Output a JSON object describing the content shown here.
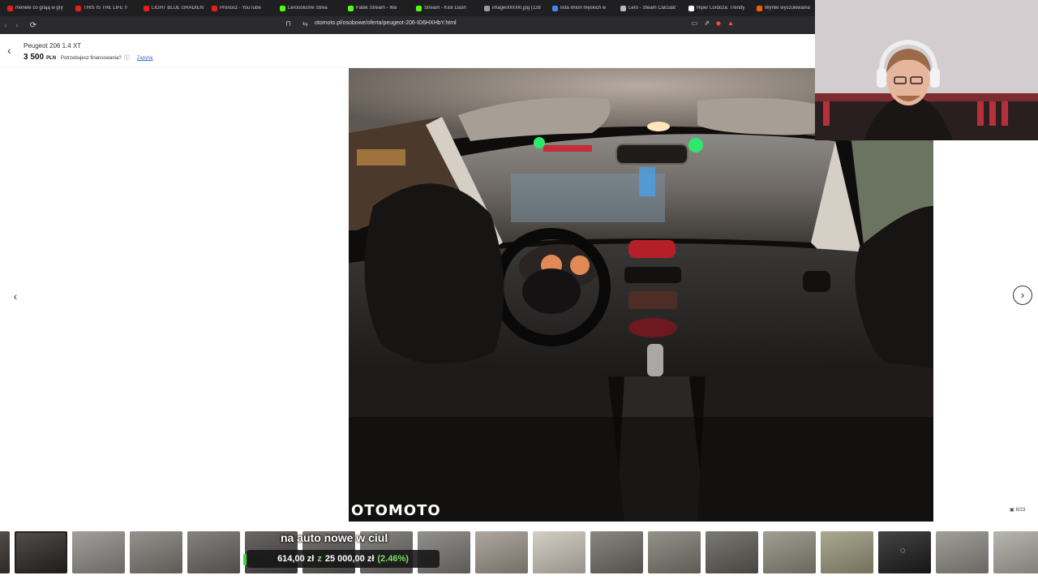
{
  "browser": {
    "tabs": [
      {
        "label": "menele co grają w gry",
        "icon": "youtube-icon",
        "color": "#e62117"
      },
      {
        "label": "THIS IS THE LIFE !!",
        "icon": "youtube-icon",
        "color": "#e62117"
      },
      {
        "label": "LIGHT BLUE GRADIEN",
        "icon": "youtube-icon",
        "color": "#e62117"
      },
      {
        "label": "Pronosz - YouTube",
        "icon": "youtube-icon",
        "color": "#e62117"
      },
      {
        "label": "Lerooolisme Strea",
        "icon": "kick-icon",
        "color": "#53fc18"
      },
      {
        "label": "Fatek Stream - Wa",
        "icon": "kick-icon",
        "color": "#53fc18"
      },
      {
        "label": "Stream - Kick Dash",
        "icon": "kick-icon",
        "color": "#53fc18"
      },
      {
        "label": "image000000.jpg (128",
        "icon": "globe-icon",
        "color": "#9a9a9a"
      },
      {
        "label": "lista imion męskich w",
        "icon": "google-icon",
        "color": "#4285f4"
      },
      {
        "label": "Lero - Steam Calculat",
        "icon": "doc-icon",
        "color": "#bbbbbb"
      },
      {
        "label": "Hiper Lordoza: Trendy",
        "icon": "tiktok-icon",
        "color": "#ffffff"
      },
      {
        "label": "Wyniki wyszukiwania",
        "icon": "allegro-icon",
        "color": "#ff5a00"
      }
    ],
    "url": "otomoto.pl/osobowe/oferta/peugeot-206-ID6HXHbY.html"
  },
  "listing": {
    "title": "Peugeot 206 1.4 XT",
    "price": "3 500",
    "currency": "PLN",
    "finance_question": "Potrzebujesz finansowania?",
    "ask_link": "Zapytaj"
  },
  "gallery": {
    "watermark": "OTOMOTO",
    "counter": "8/23",
    "current_index": 8,
    "total": 23
  },
  "overlay": {
    "caption": "na auto nowe w ciul",
    "amount": "614,00 zł",
    "separator": "z",
    "goal": "25 000,00 zł",
    "percent": "(2.46%)"
  },
  "thumbnails": [
    {
      "tone": "#3a3634"
    },
    {
      "tone": "#2a2624",
      "active": true
    },
    {
      "tone": "#8e8a86"
    },
    {
      "tone": "#7c7a74"
    },
    {
      "tone": "#6a6664"
    },
    {
      "tone": "#4a4644"
    },
    {
      "tone": "#5a5654"
    },
    {
      "tone": "#6c6a66"
    },
    {
      "tone": "#7a7874"
    },
    {
      "tone": "#9c948a"
    },
    {
      "tone": "#c9c4b8"
    },
    {
      "tone": "#6e6c66"
    },
    {
      "tone": "#7c7a70"
    },
    {
      "tone": "#5e5c56"
    },
    {
      "tone": "#8a8a7c"
    },
    {
      "tone": "#99967a"
    },
    {
      "tone": "#1c1c1c",
      "chat": true
    },
    {
      "tone": "#8c8a84"
    },
    {
      "tone": "#a8a69e"
    }
  ],
  "colors": {
    "accent": "#3b6fd8",
    "progress_green": "#7be063"
  }
}
